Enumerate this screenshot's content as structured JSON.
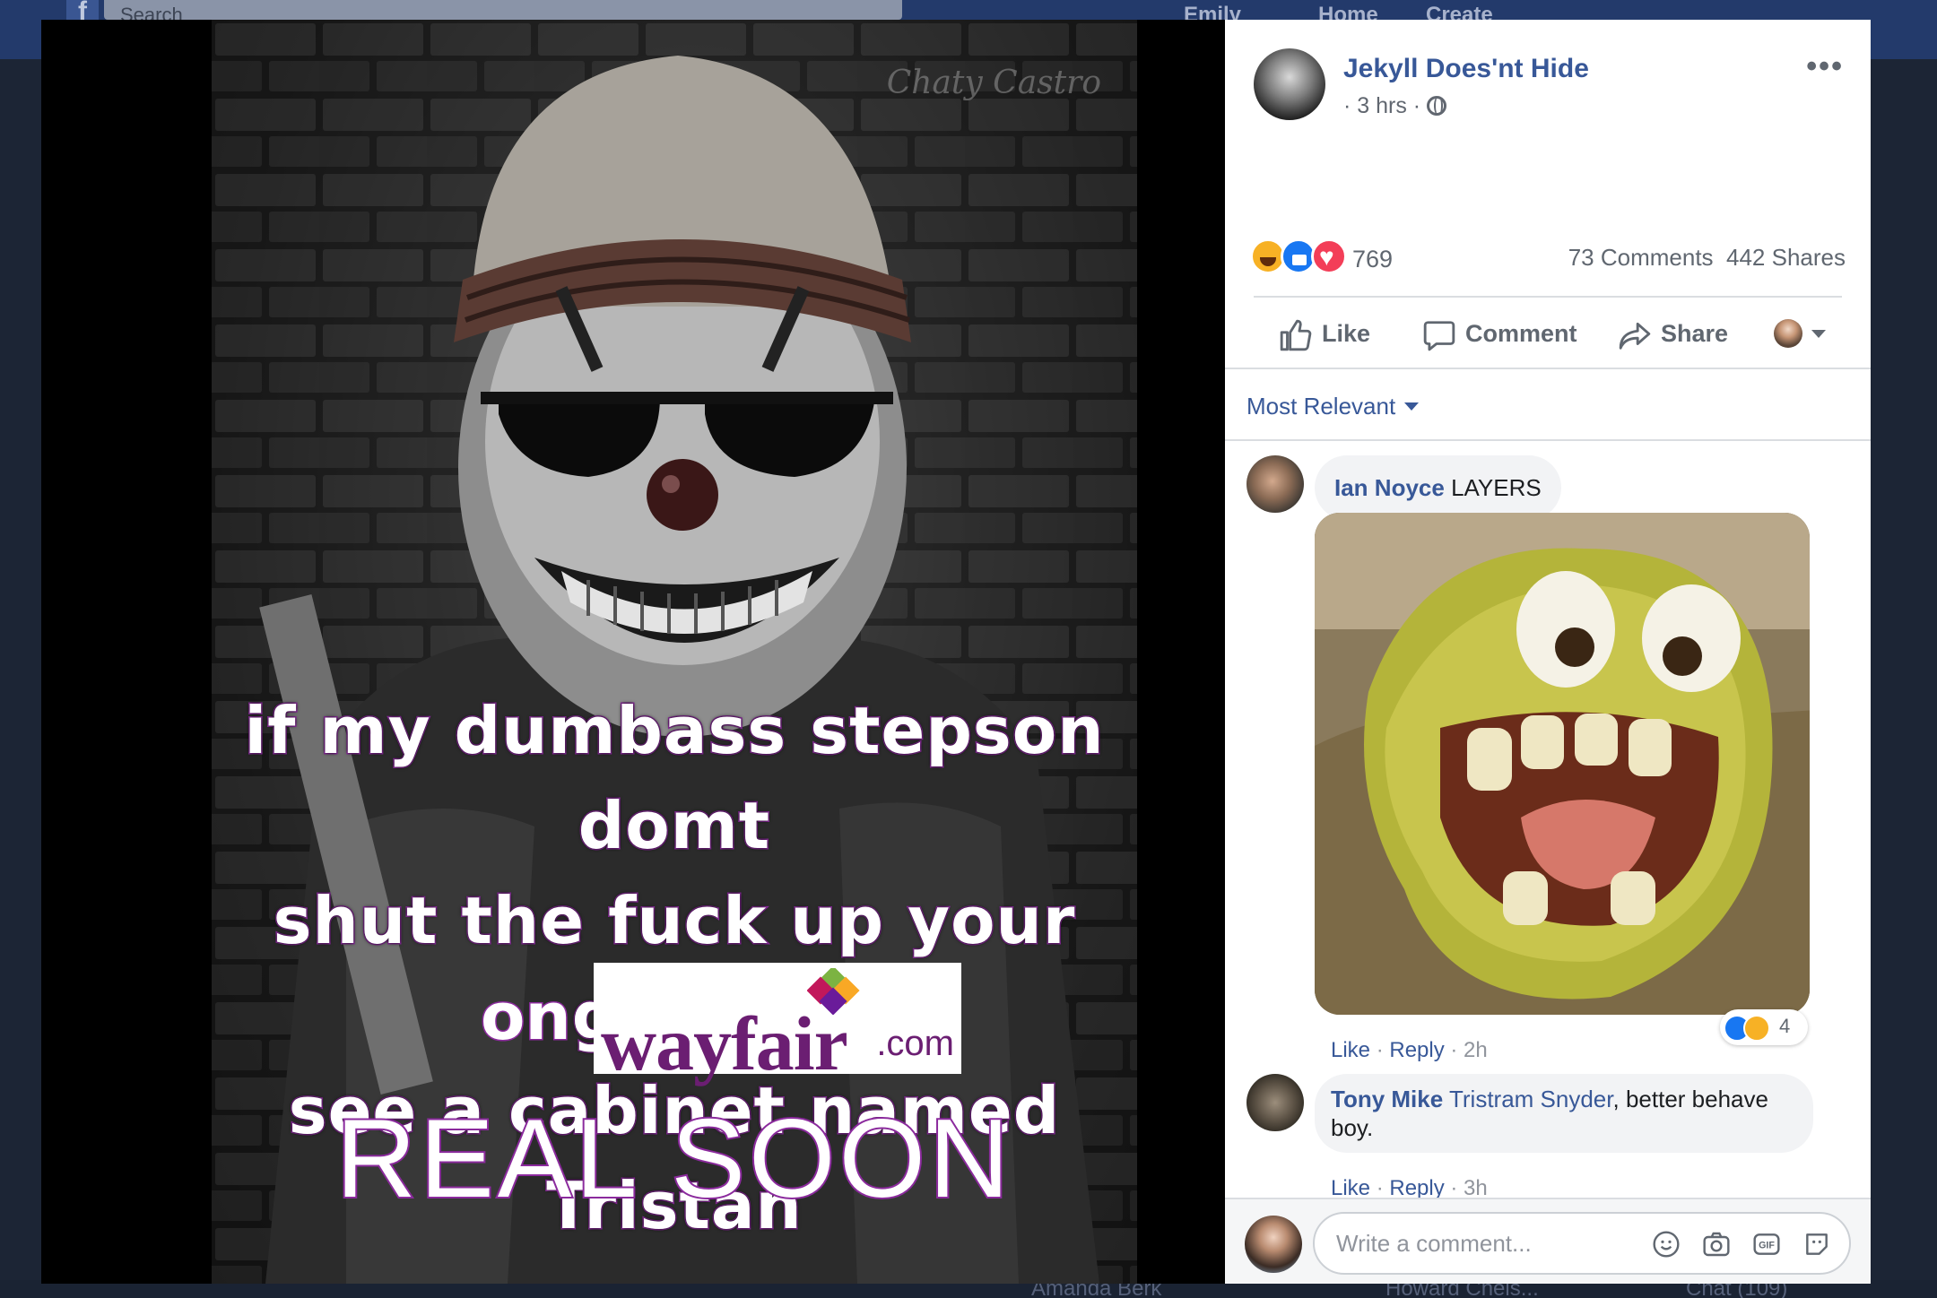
{
  "background": {
    "search_placeholder": "Search",
    "nav": [
      "Emily",
      "Home",
      "Create"
    ],
    "bottom_items": [
      "Amanda Berk",
      "Howard Chels...",
      "Chat (109)"
    ]
  },
  "photo": {
    "watermark": "Chaty Castro",
    "meme_lines": [
      "if my dumbass stepson domt",
      "shut the fuck up your goma",
      "see a cabinet named Tristan"
    ],
    "on_word": "on",
    "wayfair_word": "wayfair",
    "wayfair_com": ".com",
    "real_soon": "REAL SOON"
  },
  "post": {
    "page_name": "Jekyll Does'nt Hide",
    "time": "· 3 hrs ·",
    "more_icon": "ellipsis-icon",
    "reaction_count": "769",
    "comments": "73 Comments",
    "shares": "442 Shares",
    "reaction_icons": [
      "haha-icon",
      "like-icon",
      "love-icon"
    ]
  },
  "actions": {
    "like": "Like",
    "comment": "Comment",
    "share": "Share"
  },
  "sort": {
    "label": "Most Relevant"
  },
  "comments": [
    {
      "author": "Ian Noyce",
      "text": "LAYERS",
      "like": "Like",
      "reply": "Reply",
      "time": "2h",
      "reaction_count": "4"
    },
    {
      "author": "Tony Mike",
      "mention": "Tristram Snyder",
      "text": ", better behave boy.",
      "like": "Like",
      "reply": "Reply",
      "time": "3h"
    }
  ],
  "composer": {
    "placeholder": "Write a comment..."
  },
  "colors": {
    "link_blue": "#385898",
    "meme_purple": "#8b2a9d",
    "wayfair_purple": "#6b1e72"
  }
}
